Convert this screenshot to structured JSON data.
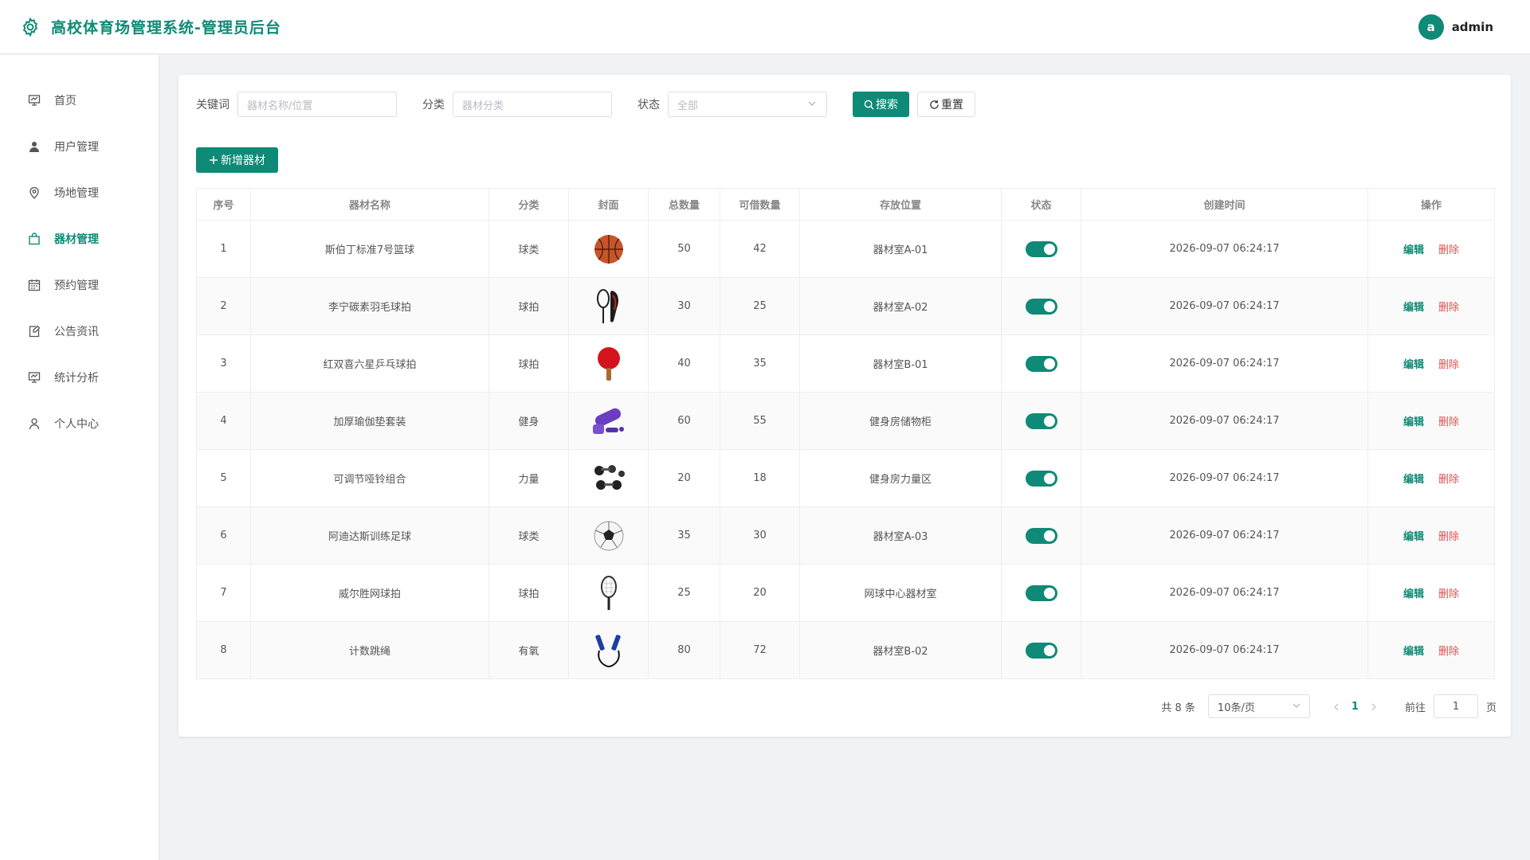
{
  "header": {
    "title": "高校体育场管理系统-管理员后台",
    "avatar_letter": "a",
    "username": "admin"
  },
  "sidebar": {
    "items": [
      {
        "label": "首页",
        "icon": "dashboard-icon"
      },
      {
        "label": "用户管理",
        "icon": "user-icon"
      },
      {
        "label": "场地管理",
        "icon": "location-icon"
      },
      {
        "label": "器材管理",
        "icon": "bag-icon",
        "active": true
      },
      {
        "label": "预约管理",
        "icon": "calendar-icon"
      },
      {
        "label": "公告资讯",
        "icon": "notice-icon"
      },
      {
        "label": "统计分析",
        "icon": "chart-icon"
      },
      {
        "label": "个人中心",
        "icon": "person-icon"
      }
    ]
  },
  "filters": {
    "keyword_label": "关键词",
    "keyword_placeholder": "器材名称/位置",
    "category_label": "分类",
    "category_placeholder": "器材分类",
    "status_label": "状态",
    "status_value": "全部",
    "search_label": "搜索",
    "reset_label": "重置"
  },
  "add_button": "新增器材",
  "table": {
    "headers": [
      "序号",
      "器材名称",
      "分类",
      "封面",
      "总数量",
      "可借数量",
      "存放位置",
      "状态",
      "创建时间",
      "操作"
    ],
    "edit_label": "编辑",
    "delete_label": "删除",
    "rows": [
      {
        "no": "1",
        "name": "斯伯丁标准7号篮球",
        "category": "球类",
        "cover": "basketball",
        "total": "50",
        "available": "42",
        "location": "器材室A-01",
        "enabled": true,
        "created": "2026-09-07 06:24:17"
      },
      {
        "no": "2",
        "name": "李宁碳素羽毛球拍",
        "category": "球拍",
        "cover": "badminton-racket",
        "total": "30",
        "available": "25",
        "location": "器材室A-02",
        "enabled": true,
        "created": "2026-09-07 06:24:17"
      },
      {
        "no": "3",
        "name": "红双喜六星乒乓球拍",
        "category": "球拍",
        "cover": "pingpong-paddle",
        "total": "40",
        "available": "35",
        "location": "器材室B-01",
        "enabled": true,
        "created": "2026-09-07 06:24:17"
      },
      {
        "no": "4",
        "name": "加厚瑜伽垫套装",
        "category": "健身",
        "cover": "yoga-mat",
        "total": "60",
        "available": "55",
        "location": "健身房储物柜",
        "enabled": true,
        "created": "2026-09-07 06:24:17"
      },
      {
        "no": "5",
        "name": "可调节哑铃组合",
        "category": "力量",
        "cover": "dumbbells",
        "total": "20",
        "available": "18",
        "location": "健身房力量区",
        "enabled": true,
        "created": "2026-09-07 06:24:17"
      },
      {
        "no": "6",
        "name": "阿迪达斯训练足球",
        "category": "球类",
        "cover": "football",
        "total": "35",
        "available": "30",
        "location": "器材室A-03",
        "enabled": true,
        "created": "2026-09-07 06:24:17"
      },
      {
        "no": "7",
        "name": "威尔胜网球拍",
        "category": "球拍",
        "cover": "tennis-racket",
        "total": "25",
        "available": "20",
        "location": "网球中心器材室",
        "enabled": true,
        "created": "2026-09-07 06:24:17"
      },
      {
        "no": "8",
        "name": "计数跳绳",
        "category": "有氧",
        "cover": "jump-rope",
        "total": "80",
        "available": "72",
        "location": "器材室B-02",
        "enabled": true,
        "created": "2026-09-07 06:24:17"
      }
    ]
  },
  "pagination": {
    "total_text": "共 8 条",
    "page_size": "10条/页",
    "current_page": "1",
    "goto_label": "前往",
    "goto_value": "1",
    "page_suffix": "页"
  },
  "colors": {
    "primary": "#0f8a76",
    "danger": "#e05050"
  }
}
